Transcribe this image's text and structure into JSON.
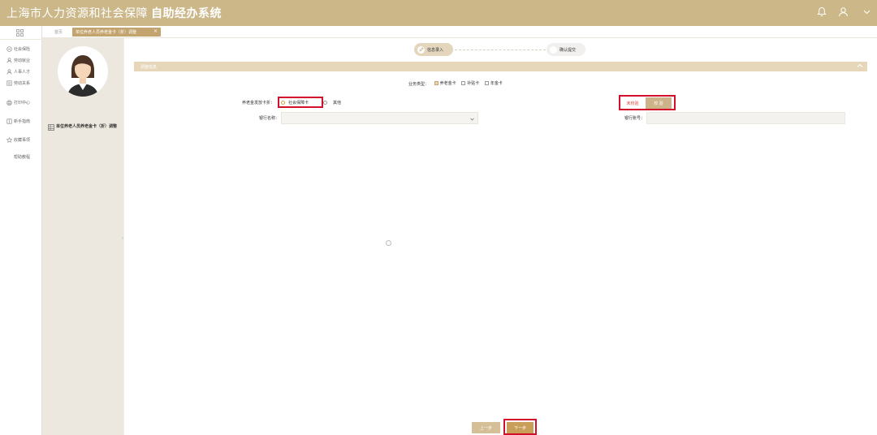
{
  "header": {
    "title_main": "上海市人力资源和社会保障",
    "title_sub": "自助经办系统",
    "icons": [
      "bell-icon",
      "user-icon",
      "chevron-down-icon"
    ]
  },
  "leftnav": {
    "items": [
      {
        "label": "社会保险",
        "icon": "shield-icon"
      },
      {
        "label": "劳动就业",
        "icon": "person-icon"
      },
      {
        "label": "人事人才",
        "icon": "people-icon"
      },
      {
        "label": "劳动关系",
        "icon": "document-icon"
      },
      {
        "label": "打印中心",
        "icon": "printer-icon"
      },
      {
        "label": "新手指南",
        "icon": "book-icon"
      },
      {
        "label": "收藏事项",
        "icon": "star-icon"
      },
      {
        "label": "帮助教程",
        "icon": ""
      }
    ]
  },
  "tabs": {
    "home": "首页",
    "active": "单位养老人员养老金卡（折）调整",
    "close": "×"
  },
  "sidepanel": {
    "menu_label": "单位养老人员养老金卡（折）调整",
    "collapse": "‹"
  },
  "steps": [
    {
      "label": "信息录入",
      "active": true
    },
    {
      "label": "确认提交",
      "active": false
    }
  ],
  "section": {
    "title": "调整信息",
    "collapse_icon": "chevron-up-icon"
  },
  "business_type": {
    "label": "业务类型：",
    "options": [
      {
        "label": "养老金卡",
        "checked": true
      },
      {
        "label": "补贴卡",
        "checked": false
      },
      {
        "label": "年金卡",
        "checked": false
      }
    ]
  },
  "pay_to": {
    "label": "养老金发放卡折：",
    "options": [
      {
        "label": "社会保障卡",
        "selected": true
      },
      {
        "label": "其他",
        "selected": false
      }
    ]
  },
  "verify": {
    "status": "未校验",
    "button": "校 验"
  },
  "bank_name": {
    "label": "银行名称：",
    "value": ""
  },
  "bank_account": {
    "label": "银行账号：",
    "value": ""
  },
  "footer": {
    "prev": "上一步",
    "next": "下一步"
  },
  "colors": {
    "header_bg": "#ccb789",
    "accent": "#c4a46e",
    "highlight": "#d2102b"
  }
}
